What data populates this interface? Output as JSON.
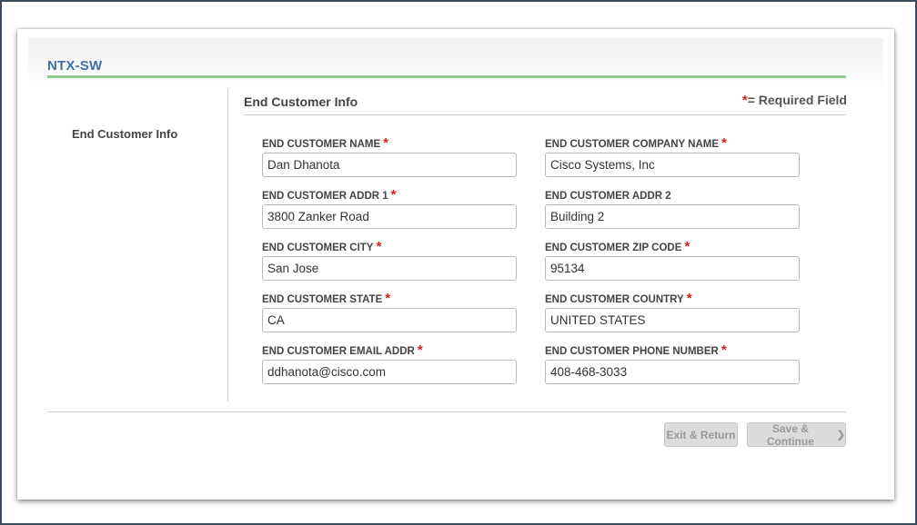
{
  "page": {
    "title": "NTX-SW"
  },
  "sidebar": {
    "label": "End Customer Info"
  },
  "section": {
    "title": "End Customer Info",
    "required_star": "*",
    "required_text": "= Required Field"
  },
  "fields": {
    "name": {
      "label": "END CUSTOMER NAME",
      "required": "*",
      "value": "Dan Dhanota"
    },
    "company": {
      "label": "END CUSTOMER COMPANY NAME",
      "required": "*",
      "value": "Cisco Systems, Inc"
    },
    "addr1": {
      "label": "END CUSTOMER ADDR 1",
      "required": "*",
      "value": "3800 Zanker Road"
    },
    "addr2": {
      "label": "END CUSTOMER ADDR 2",
      "required": "",
      "value": "Building 2"
    },
    "city": {
      "label": "END CUSTOMER CITY",
      "required": "*",
      "value": "San Jose"
    },
    "zip": {
      "label": "END CUSTOMER ZIP CODE",
      "required": "*",
      "value": "95134"
    },
    "state": {
      "label": "END CUSTOMER STATE",
      "required": "*",
      "value": "CA"
    },
    "country": {
      "label": "END CUSTOMER COUNTRY",
      "required": "*",
      "value": "UNITED STATES"
    },
    "email": {
      "label": "END CUSTOMER EMAIL ADDR",
      "required": "*",
      "value": "ddhanota@cisco.com"
    },
    "phone": {
      "label": "END CUSTOMER PHONE NUMBER",
      "required": "*",
      "value": "408-468-3033"
    }
  },
  "actions": {
    "exit_label": "Exit & Return",
    "save_label": "Save & Continue",
    "save_icon": "chevron-right-icon"
  },
  "colors": {
    "title": "#3f6fa3",
    "accent_rule": "#8fcb8f",
    "required": "#d61f1f",
    "button_disabled_bg": "#dcdcdc",
    "button_disabled_text": "#9a9a9a"
  }
}
